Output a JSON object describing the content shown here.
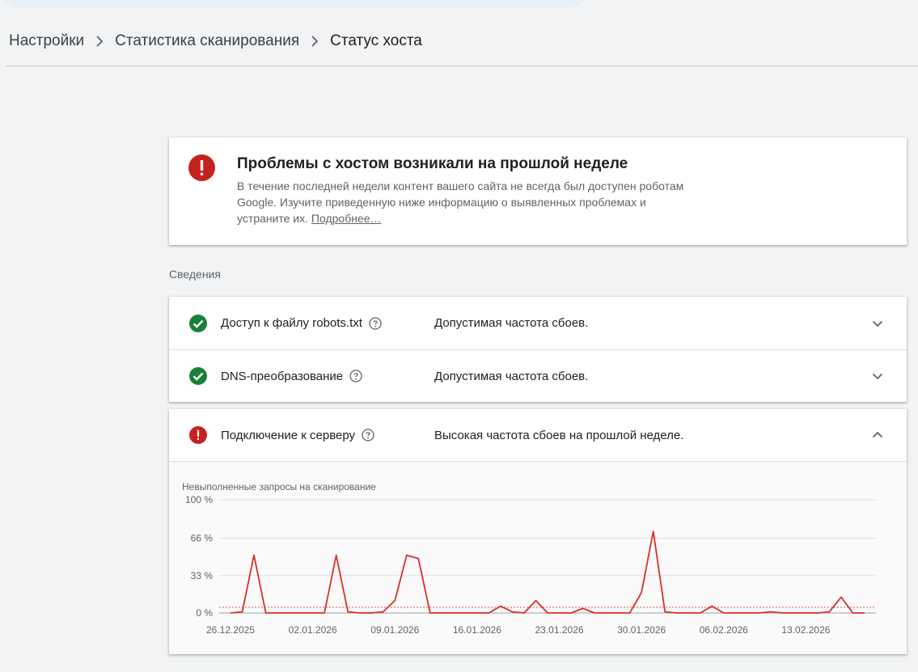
{
  "breadcrumb": {
    "items": [
      "Настройки",
      "Статистика сканирования",
      "Статус хоста"
    ]
  },
  "alert": {
    "title": "Проблемы с хостом возникали на прошлой неделе",
    "text": "В течение последней недели контент вашего сайта не всегда был доступен роботам Google. Изучите приведенную ниже информацию о выявленных проблемах и устраните их.",
    "link": "Подробнее…",
    "icon": "error-icon"
  },
  "details": {
    "label": "Сведения",
    "rows": [
      {
        "name": "Доступ к файлу robots.txt",
        "status": "ok",
        "desc": "Допустимая частота сбоев."
      },
      {
        "name": "DNS-преобразование",
        "status": "ok",
        "desc": "Допустимая частота сбоев."
      },
      {
        "name": "Подключение к серверу",
        "status": "error",
        "desc": "Высокая частота сбоев на прошлой неделе."
      }
    ]
  },
  "colors": {
    "ok": "#188038",
    "error": "#c5221f",
    "series": "#d93025",
    "threshold": "#e57373"
  },
  "chart_data": {
    "type": "line",
    "title": "Невыполненные запросы на сканирование",
    "ylim": [
      0,
      100
    ],
    "y_ticks": [
      "0 %",
      "33 %",
      "66 %",
      "100 %"
    ],
    "y_tick_values": [
      0,
      33,
      66,
      100
    ],
    "x_tick_labels": [
      "26.12.2025",
      "02.01.2026",
      "09.01.2026",
      "16.01.2026",
      "23.01.2026",
      "30.01.2026",
      "06.02.2026",
      "13.02.2026"
    ],
    "x_tick_index": [
      0,
      7,
      14,
      21,
      28,
      35,
      42,
      49
    ],
    "threshold": 5,
    "series": [
      {
        "values": [
          0,
          1,
          51,
          0,
          0,
          0,
          0,
          0,
          0,
          51,
          1,
          0,
          0,
          1,
          11,
          51,
          48,
          0,
          0,
          0,
          0,
          0,
          0,
          6,
          1,
          0,
          11,
          0,
          0,
          0,
          4,
          0,
          0,
          0,
          0,
          18,
          72,
          1,
          0,
          0,
          0,
          6,
          0,
          0,
          0,
          0,
          1,
          0,
          0,
          0,
          0,
          1,
          14,
          0,
          0
        ]
      }
    ]
  }
}
